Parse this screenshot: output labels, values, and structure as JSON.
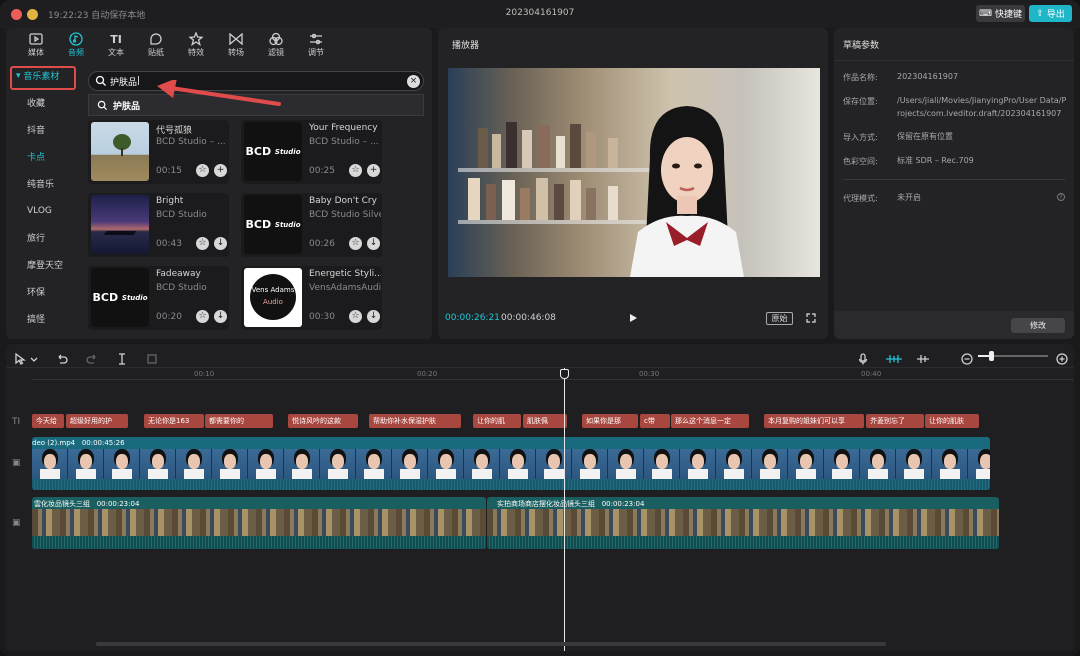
{
  "titlebar": {
    "autosave": "19:22:23 自动保存本地",
    "title": "202304161907",
    "shortcut_label": "快捷键",
    "export_label": "导出"
  },
  "media": {
    "tabs": [
      {
        "label": "媒体",
        "icon": "media-icon"
      },
      {
        "label": "音频",
        "icon": "audio-icon"
      },
      {
        "label": "文本",
        "icon": "text-icon"
      },
      {
        "label": "贴纸",
        "icon": "sticker-icon"
      },
      {
        "label": "特效",
        "icon": "effects-icon"
      },
      {
        "label": "转场",
        "icon": "transition-icon"
      },
      {
        "label": "滤镜",
        "icon": "filter-icon"
      },
      {
        "label": "调节",
        "icon": "adjust-icon"
      }
    ],
    "active_tab": "音频",
    "sidebar": {
      "head": "音乐素材",
      "items": [
        "收藏",
        "抖音",
        "卡点",
        "纯音乐",
        "VLOG",
        "旅行",
        "摩登天空",
        "环保",
        "搞怪"
      ],
      "active": "卡点"
    },
    "search": {
      "value": "护肤品"
    },
    "suggestion": "护肤品",
    "tracks": [
      {
        "name": "代号孤狼",
        "artist": "BCD Studio – ...",
        "duration": "00:15",
        "thumb": "tree",
        "action": "add"
      },
      {
        "name": "Your Frequency",
        "artist": "BCD Studio – ...",
        "duration": "00:25",
        "thumb": "bcd",
        "action": "add"
      },
      {
        "name": "Bright",
        "artist": "BCD Studio",
        "duration": "00:43",
        "thumb": "pier",
        "action": "download"
      },
      {
        "name": "Baby Don't Cry",
        "artist": "BCD Studio Silver",
        "duration": "00:26",
        "thumb": "bcd",
        "action": "download"
      },
      {
        "name": "Fadeaway",
        "artist": "BCD Studio",
        "duration": "00:20",
        "thumb": "bcd",
        "action": "download"
      },
      {
        "name": "Energetic Styli...",
        "artist": "VensAdamsAudio",
        "duration": "00:30",
        "thumb": "vens",
        "action": "download"
      }
    ],
    "bcd_logo": "BCD",
    "bcd_logo_sub": "Studio",
    "vens_logo": "Vens Adams",
    "vens_logo_sub": "Audio"
  },
  "player": {
    "title": "播放器",
    "current_time": "00:00:26:21",
    "total_time": "00:00:46:08",
    "ratio_label": "原始"
  },
  "draft": {
    "title": "草稿参数",
    "rows": [
      {
        "label": "作品名称:",
        "value": "202304161907"
      },
      {
        "label": "保存位置:",
        "value": "/Users/jiali/Movies/JianyingPro/User Data/Projects/com.lveditor.draft/202304161907"
      },
      {
        "label": "导入方式:",
        "value": "保留在原有位置"
      },
      {
        "label": "色彩空间:",
        "value": "标准 SDR – Rec.709"
      },
      {
        "label": "代理模式:",
        "value": "未开启"
      }
    ],
    "modify_label": "修改"
  },
  "timeline": {
    "ruler": [
      "00:10",
      "00:20",
      "00:30",
      "00:40"
    ],
    "text_segments": [
      "今天给",
      "超级好用的护",
      "无论你是163",
      "都需要你的",
      "悦诗风吟的这款",
      "帮助你补水保湿护肤",
      "让你的肌",
      "肌肤佩",
      "如果你是那",
      "c带",
      "那么这个消息一定",
      "本月复购的姐妹们可以享",
      "芥菱别忘了",
      "让你的肌肤"
    ],
    "video_label": "deo (2).mp4",
    "video_duration": "00:00:45:26",
    "broll": [
      {
        "label": "雲化妆品镜头三组",
        "duration": "00:00:23:04"
      },
      {
        "label": "实拍商场商店摆化妆品镜头三组",
        "duration": "00:00:23:04"
      }
    ],
    "track_icon_text": "TI"
  },
  "colors": {
    "accent": "#20c4d4",
    "annotation": "#e04b4b"
  }
}
